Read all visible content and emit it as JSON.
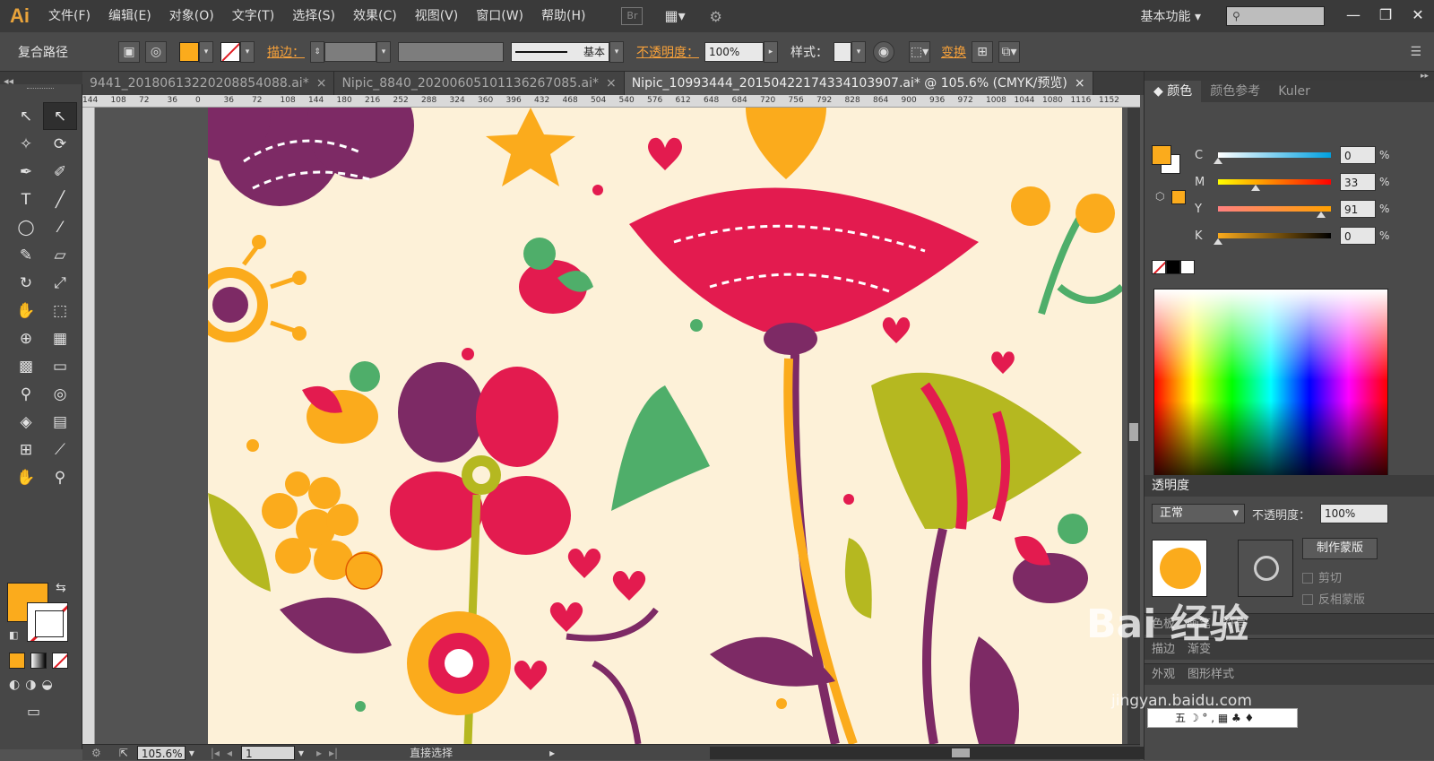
{
  "menubar": {
    "logo": "Ai",
    "items": [
      "文件(F)",
      "编辑(E)",
      "对象(O)",
      "文字(T)",
      "选择(S)",
      "效果(C)",
      "视图(V)",
      "窗口(W)",
      "帮助(H)"
    ],
    "bridge_label": "Br",
    "workspace": "基本功能",
    "window_buttons": [
      "—",
      "❐",
      "✕"
    ]
  },
  "control_bar": {
    "selection_label": "复合路径",
    "fill_color": "#fbab1c",
    "stroke_label": "描边：",
    "brush_label": "基本",
    "opacity_label": "不透明度：",
    "opacity_value": "100%",
    "style_label": "样式：",
    "transform_label": "变换"
  },
  "document_tabs": [
    {
      "label": "9441_20180613220208854088.ai*",
      "active": false
    },
    {
      "label": "Nipic_8840_20200605101136267085.ai*",
      "active": false
    },
    {
      "label": "Nipic_10993444_20150422174334103907.ai* @ 105.6% (CMYK/预览)",
      "active": true
    }
  ],
  "ruler_ticks": [
    "144",
    "108",
    "72",
    "36",
    "0",
    "36",
    "72",
    "108",
    "144",
    "180",
    "216",
    "252",
    "288",
    "324",
    "360",
    "396",
    "432",
    "468",
    "504",
    "540",
    "576",
    "612",
    "648",
    "684",
    "720",
    "756",
    "792",
    "828",
    "864",
    "900",
    "936",
    "972",
    "1008",
    "1044",
    "1080",
    "1116",
    "1152"
  ],
  "tools": [
    {
      "name": "selection-tool",
      "glyph": "↖"
    },
    {
      "name": "direct-selection-tool",
      "glyph": "↖"
    },
    {
      "name": "magic-wand-tool",
      "glyph": "✧"
    },
    {
      "name": "lasso-tool",
      "glyph": "⟳"
    },
    {
      "name": "pen-tool",
      "glyph": "✒"
    },
    {
      "name": "curvature-tool",
      "glyph": "✐"
    },
    {
      "name": "type-tool",
      "glyph": "T"
    },
    {
      "name": "line-tool",
      "glyph": "╱"
    },
    {
      "name": "ellipse-tool",
      "glyph": "◯"
    },
    {
      "name": "paintbrush-tool",
      "glyph": "⁄"
    },
    {
      "name": "pencil-tool",
      "glyph": "✎"
    },
    {
      "name": "eraser-tool",
      "glyph": "▱"
    },
    {
      "name": "rotate-tool",
      "glyph": "↻"
    },
    {
      "name": "scale-tool",
      "glyph": "⤢"
    },
    {
      "name": "warp-tool",
      "glyph": "✋"
    },
    {
      "name": "free-transform-tool",
      "glyph": "⬚"
    },
    {
      "name": "shape-builder-tool",
      "glyph": "⊕"
    },
    {
      "name": "perspective-grid-tool",
      "glyph": "▦"
    },
    {
      "name": "mesh-tool",
      "glyph": "▩"
    },
    {
      "name": "gradient-tool",
      "glyph": "▭"
    },
    {
      "name": "eyedropper-tool",
      "glyph": "⚲"
    },
    {
      "name": "blend-tool",
      "glyph": "◎"
    },
    {
      "name": "symbol-sprayer-tool",
      "glyph": "◈"
    },
    {
      "name": "column-graph-tool",
      "glyph": "▤"
    },
    {
      "name": "artboard-tool",
      "glyph": "⊞"
    },
    {
      "name": "slice-tool",
      "glyph": "⟋"
    },
    {
      "name": "hand-tool",
      "glyph": "✋"
    },
    {
      "name": "zoom-tool",
      "glyph": "⚲"
    }
  ],
  "toolbar_colors": {
    "fill": "#fbab1c",
    "stroke": "none"
  },
  "status_bar": {
    "zoom": "105.6%",
    "artboard": "1",
    "tool_name": "直接选择"
  },
  "color_panel": {
    "tabs": [
      "颜色",
      "颜色参考",
      "Kuler"
    ],
    "channels": [
      {
        "label": "C",
        "value": "0",
        "gradient": [
          "#ffffff",
          "#00a0e0"
        ],
        "fraction": 0.0
      },
      {
        "label": "M",
        "value": "33",
        "gradient": [
          "#ffff00",
          "#ff0000"
        ],
        "fraction": 0.33
      },
      {
        "label": "Y",
        "value": "91",
        "gradient": [
          "#ff8080",
          "#ffa000"
        ],
        "fraction": 0.91
      },
      {
        "label": "K",
        "value": "0",
        "gradient": [
          "#fbab1c",
          "#000000"
        ],
        "fraction": 0.0
      }
    ],
    "unit": "%"
  },
  "transparency_panel": {
    "title": "透明度",
    "blend_mode": "正常",
    "opacity_label": "不透明度：",
    "opacity_value": "100%",
    "mask_button": "制作蒙版",
    "clip_label": "剪切",
    "invert_label": "反相蒙版"
  },
  "collapsed_panels": [
    {
      "labels": [
        "色板",
        "画笔",
        "符号"
      ]
    },
    {
      "labels": [
        "描边",
        "渐变"
      ]
    },
    {
      "labels": [
        "外观",
        "图形样式"
      ]
    }
  ],
  "watermark": {
    "text": "Bai 经验",
    "sub": "jingyan.baidu.com"
  }
}
